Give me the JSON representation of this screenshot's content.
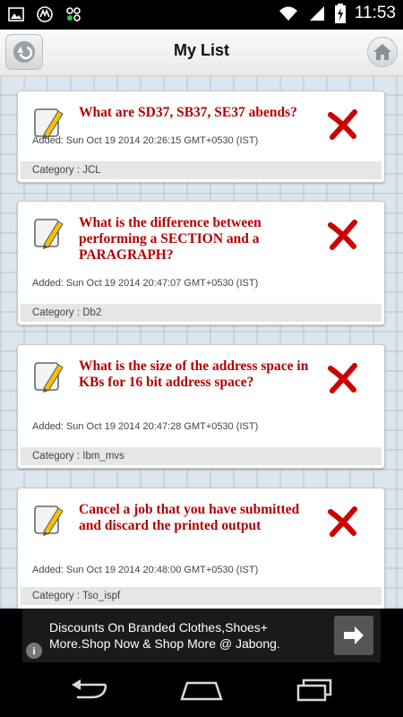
{
  "status_bar": {
    "time": "11:53",
    "icons": [
      "image-icon",
      "motorola-icon",
      "network-share-icon",
      "wifi-icon",
      "signal-icon",
      "battery-icon"
    ]
  },
  "header": {
    "title": "My List",
    "back_icon": "back-arrow-icon",
    "home_icon": "home-icon"
  },
  "items": [
    {
      "question": "What are SD37, SB37, SE37 abends?",
      "added": "Added: Sun Oct 19 2014 20:26:15 GMT+0530 (IST)",
      "category": "Category : JCL"
    },
    {
      "question": "What is the difference between performing a SECTION and a PARAGRAPH?",
      "added": "Added: Sun Oct 19 2014 20:47:07 GMT+0530 (IST)",
      "category": "Category : Db2"
    },
    {
      "question": "What is the size of the address space in KBs for 16 bit address space?",
      "added": "Added: Sun Oct 19 2014 20:47:28 GMT+0530 (IST)",
      "category": "Category : Ibm_mvs"
    },
    {
      "question": "Cancel a job that you have submitted and discard the printed output",
      "added": "Added: Sun Oct 19 2014 20:48:00 GMT+0530 (IST)",
      "category": "Category : Tso_ispf"
    }
  ],
  "ad": {
    "text": "Discounts On Branded Clothes,Shoes+ More.Shop Now & Shop More @ Jabong.",
    "info_glyph": "i"
  },
  "colors": {
    "question_text": "#b30000",
    "delete_icon": "#cc0000"
  }
}
